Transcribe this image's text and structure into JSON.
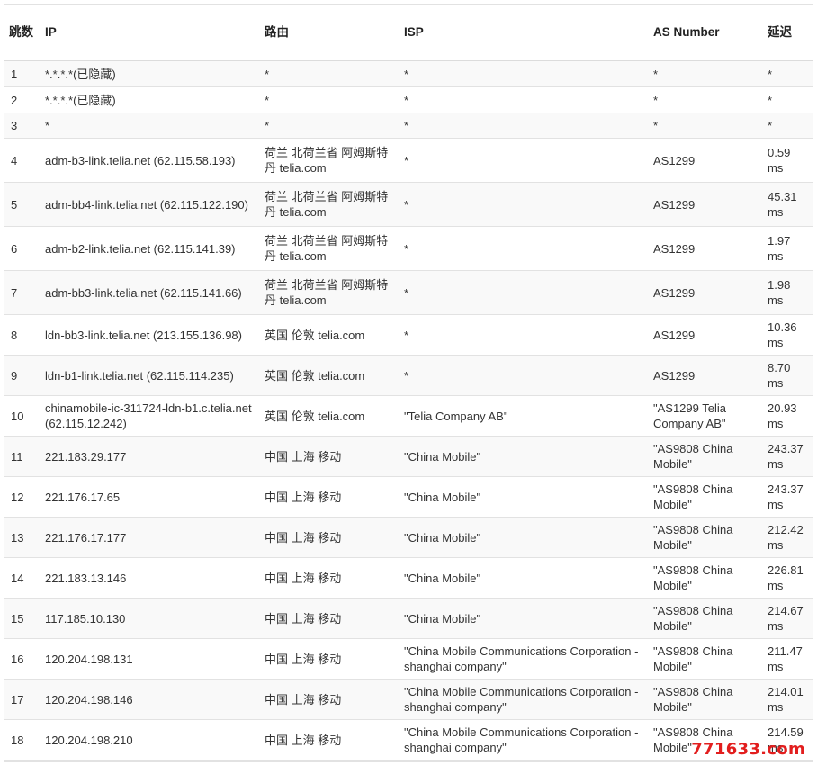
{
  "table": {
    "headers": {
      "hop": "跳数",
      "ip": "IP",
      "route": "路由",
      "isp": "ISP",
      "as": "AS Number",
      "latency": "延迟"
    },
    "rows": [
      {
        "hop": "1",
        "ip": "*.*.*.*(已隐藏)",
        "route": "*",
        "isp": "*",
        "as": "*",
        "latency": "*"
      },
      {
        "hop": "2",
        "ip": "*.*.*.*(已隐藏)",
        "route": "*",
        "isp": "*",
        "as": "*",
        "latency": "*"
      },
      {
        "hop": "3",
        "ip": "*",
        "route": "*",
        "isp": "*",
        "as": "*",
        "latency": "*"
      },
      {
        "hop": "4",
        "ip": "adm-b3-link.telia.net (62.115.58.193)",
        "route": "荷兰 北荷兰省 阿姆斯特丹 telia.com",
        "isp": "*",
        "as": "AS1299",
        "latency": "0.59 ms"
      },
      {
        "hop": "5",
        "ip": "adm-bb4-link.telia.net (62.115.122.190)",
        "route": "荷兰 北荷兰省 阿姆斯特丹 telia.com",
        "isp": "*",
        "as": "AS1299",
        "latency": "45.31 ms"
      },
      {
        "hop": "6",
        "ip": "adm-b2-link.telia.net (62.115.141.39)",
        "route": "荷兰 北荷兰省 阿姆斯特丹 telia.com",
        "isp": "*",
        "as": "AS1299",
        "latency": "1.97 ms"
      },
      {
        "hop": "7",
        "ip": "adm-bb3-link.telia.net (62.115.141.66)",
        "route": "荷兰 北荷兰省 阿姆斯特丹 telia.com",
        "isp": "*",
        "as": "AS1299",
        "latency": "1.98 ms"
      },
      {
        "hop": "8",
        "ip": "ldn-bb3-link.telia.net (213.155.136.98)",
        "route": "英国 伦敦 telia.com",
        "isp": "*",
        "as": "AS1299",
        "latency": "10.36 ms"
      },
      {
        "hop": "9",
        "ip": "ldn-b1-link.telia.net (62.115.114.235)",
        "route": "英国 伦敦 telia.com",
        "isp": "*",
        "as": "AS1299",
        "latency": "8.70 ms"
      },
      {
        "hop": "10",
        "ip": "chinamobile-ic-311724-ldn-b1.c.telia.net (62.115.12.242)",
        "route": "英国 伦敦 telia.com",
        "isp": "\"Telia Company AB\"",
        "as": "\"AS1299 Telia Company AB\"",
        "latency": "20.93 ms"
      },
      {
        "hop": "11",
        "ip": "221.183.29.177",
        "route": "中国 上海 移动",
        "isp": "\"China Mobile\"",
        "as": "\"AS9808 China Mobile\"",
        "latency": "243.37 ms"
      },
      {
        "hop": "12",
        "ip": "221.176.17.65",
        "route": "中国 上海 移动",
        "isp": "\"China Mobile\"",
        "as": "\"AS9808 China Mobile\"",
        "latency": "243.37 ms"
      },
      {
        "hop": "13",
        "ip": "221.176.17.177",
        "route": "中国 上海 移动",
        "isp": "\"China Mobile\"",
        "as": "\"AS9808 China Mobile\"",
        "latency": "212.42 ms"
      },
      {
        "hop": "14",
        "ip": "221.183.13.146",
        "route": "中国 上海 移动",
        "isp": "\"China Mobile\"",
        "as": "\"AS9808 China Mobile\"",
        "latency": "226.81 ms"
      },
      {
        "hop": "15",
        "ip": "117.185.10.130",
        "route": "中国 上海 移动",
        "isp": "\"China Mobile\"",
        "as": "\"AS9808 China Mobile\"",
        "latency": "214.67 ms"
      },
      {
        "hop": "16",
        "ip": "120.204.198.131",
        "route": "中国 上海 移动",
        "isp": "\"China Mobile Communications Corporation - shanghai company\"",
        "as": "\"AS9808 China Mobile\"",
        "latency": "211.47 ms"
      },
      {
        "hop": "17",
        "ip": "120.204.198.146",
        "route": "中国 上海 移动",
        "isp": "\"China Mobile Communications Corporation - shanghai company\"",
        "as": "\"AS9808 China Mobile\"",
        "latency": "214.01 ms"
      },
      {
        "hop": "18",
        "ip": "120.204.198.210",
        "route": "中国 上海 移动",
        "isp": "\"China Mobile Communications Corporation - shanghai company\"",
        "as": "\"AS9808 China Mobile\"",
        "latency": "214.59 ms"
      }
    ]
  },
  "watermark": {
    "text": "771633.com",
    "color": "#e21e1e"
  }
}
